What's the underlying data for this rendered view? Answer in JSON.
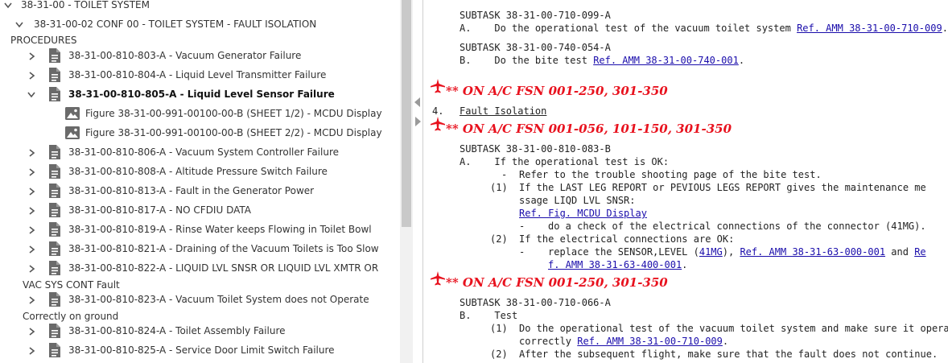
{
  "tree": {
    "items": [
      {
        "label": "38-31-00 - TOILET SYSTEM"
      },
      {
        "label": "38-31-00-02 CONF 00 - TOILET SYSTEM - FAULT ISOLATION"
      },
      {
        "label": "PROCEDURES"
      },
      {
        "label": "38-31-00-810-803-A - Vacuum Generator Failure"
      },
      {
        "label": "38-31-00-810-804-A - Liquid Level Transmitter Failure"
      },
      {
        "label": "38-31-00-810-805-A - Liquid Level Sensor Failure"
      },
      {
        "label": "Figure 38-31-00-991-00100-00-B (SHEET 1/2) - MCDU Display"
      },
      {
        "label": "Figure 38-31-00-991-00100-00-B (SHEET 2/2) - MCDU Display"
      },
      {
        "label": "38-31-00-810-806-A - Vacuum System Controller Failure"
      },
      {
        "label": "38-31-00-810-808-A - Altitude Pressure Switch Failure"
      },
      {
        "label": "38-31-00-810-813-A - Fault in the Generator Power"
      },
      {
        "label": "38-31-00-810-817-A - NO CFDIU DATA"
      },
      {
        "label": "38-31-00-810-819-A - Rinse Water keeps Flowing in Toilet Bowl"
      },
      {
        "label": "38-31-00-810-821-A - Draining of the Vacuum Toilets is Too Slow"
      },
      {
        "label": "38-31-00-810-822-A - LIQUID LVL SNSR OR LIQUID LVL XMTR OR"
      },
      {
        "label": "VAC SYS CONT Fault"
      },
      {
        "label": "38-31-00-810-823-A - Vacuum Toilet System does not Operate"
      },
      {
        "label": "Correctly on ground"
      },
      {
        "label": "38-31-00-810-824-A - Toilet Assembly Failure"
      },
      {
        "label": "38-31-00-810-825-A - Service Door Limit Switch Failure"
      }
    ]
  },
  "content": {
    "st1_title": "SUBTASK 38-31-00-710-099-A",
    "st1_a_marker": "A.",
    "st1_a_text": "Do the operational test of the vacuum toilet system",
    "st1_a_link": "Ref. AMM 38-31-00-710-009",
    "st1_a_end": ".",
    "st2_title": "SUBTASK 38-31-00-740-054-A",
    "st2_b_marker": "B.",
    "st2_b_text": "Do the bite test",
    "st2_b_link": "Ref. AMM 38-31-00-740-001",
    "st2_b_end": ".",
    "eff1": "** ON A/C FSN 001-250, 301-350",
    "fi_num": "4.",
    "fi_title": "Fault Isolation",
    "eff2": "** ON A/C FSN 001-056, 101-150, 301-350",
    "st3_title": "SUBTASK 38-31-00-810-083-B",
    "st3_a_marker": "A.",
    "st3_a_text": "If the operational test is OK:",
    "st3_dash1": "-",
    "st3_dash1_text": "Refer to the trouble shooting page of the bite test.",
    "st3_1_marker": "(1)",
    "st3_1_text_a": "If the LAST LEG REPORT or PEVIOUS LEGS REPORT gives the maintenance me",
    "st3_1_text_b": "ssage LIQD LVL SNSR:",
    "st3_1_link": "Ref. Fig. MCDU Display",
    "st3_dash2": "-",
    "st3_dash2_text": "do a check of the electrical connections of the connector (41MG).",
    "st3_2_marker": "(2)",
    "st3_2_text": "If the electrical connections are OK:",
    "st3_dash3": "-",
    "st3_dash3_pre": "replace the SENSOR,LEVEL (",
    "st3_dash3_link1": "41MG",
    "st3_dash3_mid": "), ",
    "st3_dash3_link2": "Ref. AMM 38-31-63-000-001",
    "st3_dash3_and": " and ",
    "st3_dash3_link3a": "Re",
    "st3_dash3_link3b": "f. AMM 38-31-63-400-001",
    "st3_dash3_end": ".",
    "eff3": "** ON A/C FSN 001-250, 301-350",
    "st4_title": "SUBTASK 38-31-00-710-066-A",
    "st4_b_marker": "B.",
    "st4_b_text": "Test",
    "st4_1_marker": "(1)",
    "st4_1_text": "Do the operational test of the vacuum toilet system and make sure it operates",
    "st4_1_text_b": "correctly ",
    "st4_1_link": "Ref. AMM 38-31-00-710-009",
    "st4_1_end": ".",
    "st4_2_marker": "(2)",
    "st4_2_text": "After the subsequent flight, make sure that the fault does not continue."
  },
  "colors": {
    "effectivity": "#e8121e",
    "link": "#1a0dab",
    "icon": "#6a6a6a"
  },
  "icons": [
    "chevron-right-icon",
    "chevron-down-icon",
    "document-icon",
    "image-icon",
    "airplane-icon"
  ]
}
